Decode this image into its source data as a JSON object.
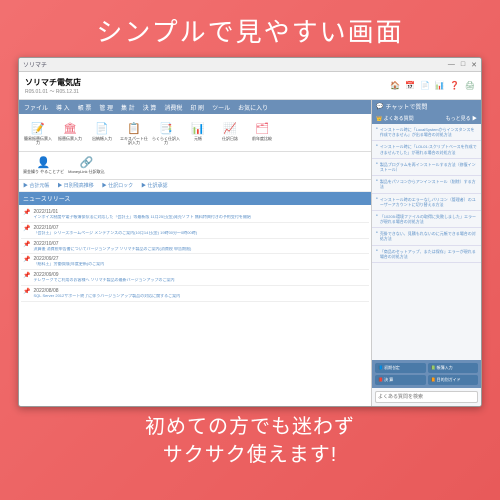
{
  "headline": "シンプルで見やすい画面",
  "tagline_l1": "初めての方でも迷わず",
  "tagline_l2": "サクサク使えます!",
  "titlebar": {
    "title": "ソリマチ"
  },
  "store": {
    "name": "ソリマチ電気店",
    "period": "R05.01.01 ～ R05.12.31"
  },
  "menu": [
    "ファイル",
    "導 入",
    "帳 票",
    "管 理",
    "集 計",
    "決 算",
    "消費税",
    "印 刷",
    "ツール",
    "お気に入り"
  ],
  "ribbon": [
    {
      "icon": "📝",
      "color": "#e67",
      "label": "簡易振替伝票入力"
    },
    {
      "icon": "🏛",
      "color": "#e67",
      "label": "振替伝票入力"
    },
    {
      "icon": "📄",
      "color": "#4a8",
      "label": "出納帳入力"
    },
    {
      "icon": "📋",
      "color": "#4a8",
      "label": "エキスパート仕訳入力"
    },
    {
      "icon": "📑",
      "color": "#4a8",
      "label": "らくらく仕訳入力"
    },
    {
      "icon": "📊",
      "color": "#e55",
      "label": "元帳"
    },
    {
      "icon": "📈",
      "color": "#e55",
      "label": "仕訳日誌"
    },
    {
      "icon": "🗂",
      "color": "#e67",
      "label": "前年度比較"
    }
  ],
  "row2": [
    {
      "icon": "👤",
      "label": "資金繰り\nやることナビ"
    },
    {
      "icon": "🔗",
      "label": "MoneyLink\n仕訳取込"
    }
  ],
  "links": [
    "▶ 合計元帳",
    "▶ 日別残高推移",
    "▶ 仕訳ロック",
    "▶ 仕訳承認"
  ],
  "news_header": "ニュースリリース",
  "news": [
    {
      "date": "2022/11/01",
      "title": "インボイス制度や電子帳簿保存法に対応した「会計王」等最新版 11月25日(金)発売ソフト 無料特典付きの予約受付を開始"
    },
    {
      "date": "2022/10/07",
      "title": "「会計王」シリーズホームページ メンテナンスのご案内(10月14日(金) 19時00分～0時00時)"
    },
    {
      "date": "2022/10/07",
      "title": "決算後 消費税申告書についてバージョンアップ ソリマチ製品のご案内(消費税 申告期限)"
    },
    {
      "date": "2022/09/27",
      "title": "「給料王」労働保険(年度更新)のご案内"
    },
    {
      "date": "2022/09/09",
      "title": "テレワークでご利用のお客様へ ソリマチ製品の最新バージョンアップのご案内"
    },
    {
      "date": "2022/08/08",
      "title": "SQL Server 2012サポート終了に伴うバージョンアップ製品の対応に関するご案内"
    }
  ],
  "sidebar": {
    "chat": "チャットで質問",
    "faq_header": "👑 よくある質問",
    "faq_more": "もっと見る ▶",
    "faqs": [
      "インストール時に「LocalSystemからインスタンスを作成できません」が出る場合の対処方法",
      "インストール時に「LOL01:スクリプトベースを作成できませんでした」が現れる場合の対処方法",
      "製品プログラムを再インストールする方法（修復インストール）",
      "製品をパソコンからアンインストール（削除）する方法",
      "インストール時のエラーなしバリコン（管理者）のユーザーアカウントに切り替える方法",
      "「10205:環境ファイルの取得に失敗しました」エラーが現れる場合の対処方法",
      "売掛できない、見積もれないのに元帳できる場合の対処方法",
      "「商品のセットアップ、または保存」エラーが現れる場合の対処方法"
    ],
    "buttons": [
      "📘 初期설定",
      "📗 帳簿入力",
      "📕 決 算",
      "📙 目的別ガイド"
    ],
    "search_placeholder": "よくある質問を検索"
  }
}
